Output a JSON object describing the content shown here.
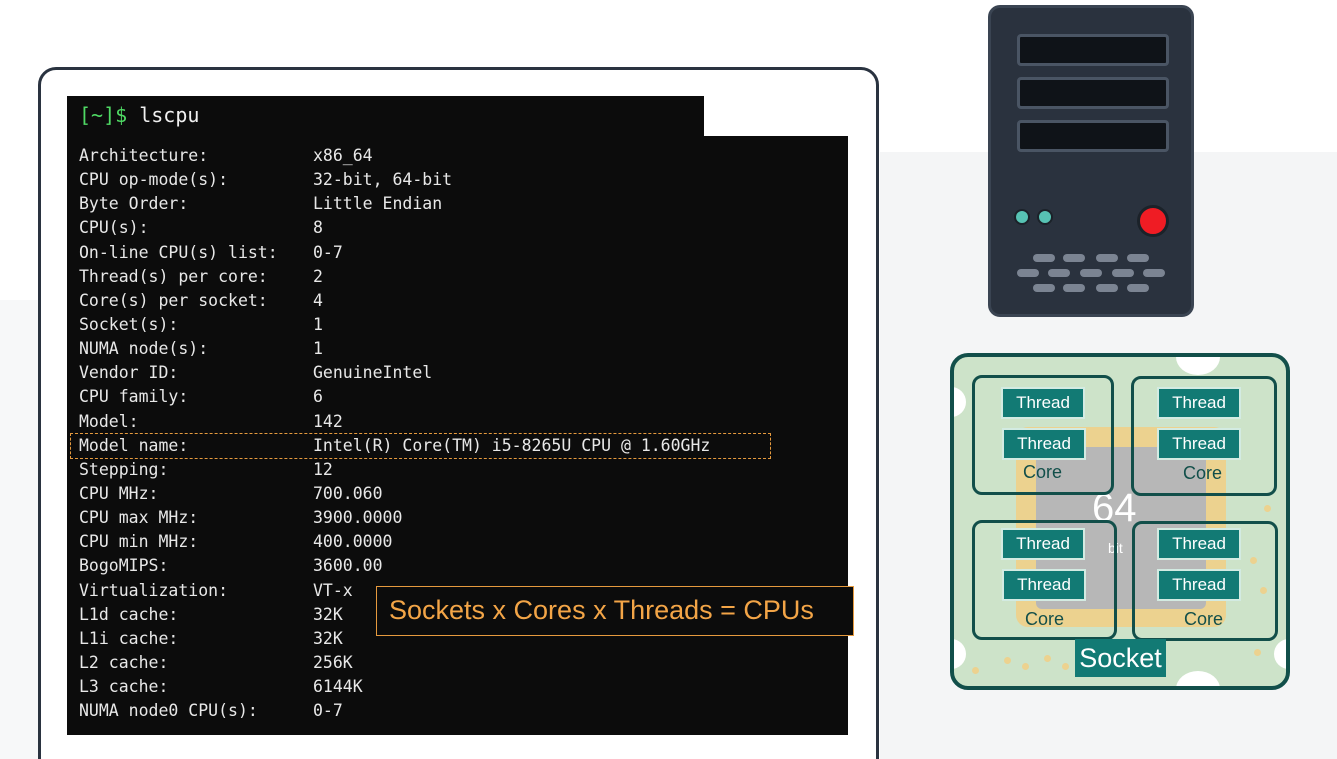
{
  "terminal": {
    "prompt_symbol": "[~]$",
    "command": " lscpu",
    "rows": [
      {
        "key": "Architecture:",
        "value": "x86_64"
      },
      {
        "key": "CPU op-mode(s):",
        "value": "32-bit, 64-bit"
      },
      {
        "key": "Byte Order:",
        "value": "Little Endian"
      },
      {
        "key": "CPU(s):",
        "value": "8"
      },
      {
        "key": "On-line CPU(s) list:",
        "value": "0-7"
      },
      {
        "key": "Thread(s) per core:",
        "value": "2"
      },
      {
        "key": "Core(s) per socket:",
        "value": "4"
      },
      {
        "key": "Socket(s):",
        "value": "1"
      },
      {
        "key": "NUMA node(s):",
        "value": "1"
      },
      {
        "key": "Vendor ID:",
        "value": "GenuineIntel"
      },
      {
        "key": "CPU family:",
        "value": "6"
      },
      {
        "key": "Model:",
        "value": "142"
      },
      {
        "key": "Model name:",
        "value": "Intel(R) Core(TM) i5-8265U CPU @ 1.60GHz"
      },
      {
        "key": "Stepping:",
        "value": "12"
      },
      {
        "key": "CPU MHz:",
        "value": "700.060"
      },
      {
        "key": "CPU max MHz:",
        "value": "3900.0000"
      },
      {
        "key": "CPU min MHz:",
        "value": "400.0000"
      },
      {
        "key": "BogoMIPS:",
        "value": "3600.00"
      },
      {
        "key": "Virtualization:",
        "value": "VT-x"
      },
      {
        "key": "L1d cache:",
        "value": "32K"
      },
      {
        "key": "L1i cache:",
        "value": "32K"
      },
      {
        "key": "L2 cache:",
        "value": "256K"
      },
      {
        "key": "L3 cache:",
        "value": "6144K"
      },
      {
        "key": "NUMA node0 CPU(s):",
        "value": "0-7"
      }
    ],
    "highlighted_row": "Model name:"
  },
  "callout": {
    "text": "Sockets x Cores x Threads = CPUs",
    "color": "#f3a547"
  },
  "server": {
    "icon": "server-tower-icon",
    "status_led_color": "#ef1c24",
    "led_color": "#57c3b4"
  },
  "chip": {
    "center_text": "64",
    "center_sub": "bit",
    "thread_label": "Thread",
    "core_label": "Core",
    "socket_label": "Socket",
    "colors": {
      "board": "#cde3c9",
      "border": "#124f4a",
      "thread": "#127a74",
      "die": "#ecd28f"
    }
  }
}
